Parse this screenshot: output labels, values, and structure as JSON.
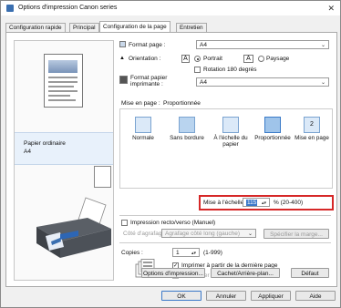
{
  "window": {
    "title": "Options d'impression Canon        series"
  },
  "tabs": [
    {
      "label": "Configuration rapide"
    },
    {
      "label": "Principal"
    },
    {
      "label": "Configuration de la page"
    },
    {
      "label": "Entretien"
    }
  ],
  "preview": {
    "media_type": "Papier ordinaire",
    "paper_size": "A4"
  },
  "page_settings": {
    "page_size_label": "Format page :",
    "page_size_value": "A4",
    "orientation_label": "Orientation :",
    "portrait_label": "Portrait",
    "landscape_label": "Paysage",
    "rotate_label": "Rotation 180 degrés",
    "printer_paper_size_label": "Format papier imprimante :",
    "printer_paper_size_value": "A4"
  },
  "layout": {
    "label": "Mise en page :",
    "current": "Proportionnée",
    "options": [
      {
        "label": "Normale"
      },
      {
        "label": "Sans bordure"
      },
      {
        "label": "À l'échelle du papier"
      },
      {
        "label": "Proportionnée"
      },
      {
        "label": "Mise en page"
      }
    ]
  },
  "scaling": {
    "label": "Mise à l'échelle :",
    "value": "115",
    "range": "% (20-400)"
  },
  "duplex": {
    "label": "Impression recto/verso (Manuel)",
    "stapling_side_label": "Côté d'agrafage :",
    "stapling_side_value": "Agrafage côté long (gauche)",
    "margin_button": "Spécifier la marge..."
  },
  "copies": {
    "label": "Copies :",
    "value": "1",
    "range": "(1-999)",
    "reverse_label": "Imprimer à partir de la dernière page",
    "collate_label": "Assembler"
  },
  "bottom_buttons": {
    "print_options": "Options d'impression...",
    "stamp_background": "Cachet/Arrière-plan...",
    "defaults": "Défaut"
  },
  "dialog_buttons": {
    "ok": "OK",
    "cancel": "Annuler",
    "apply": "Appliquer",
    "help": "Aide"
  }
}
